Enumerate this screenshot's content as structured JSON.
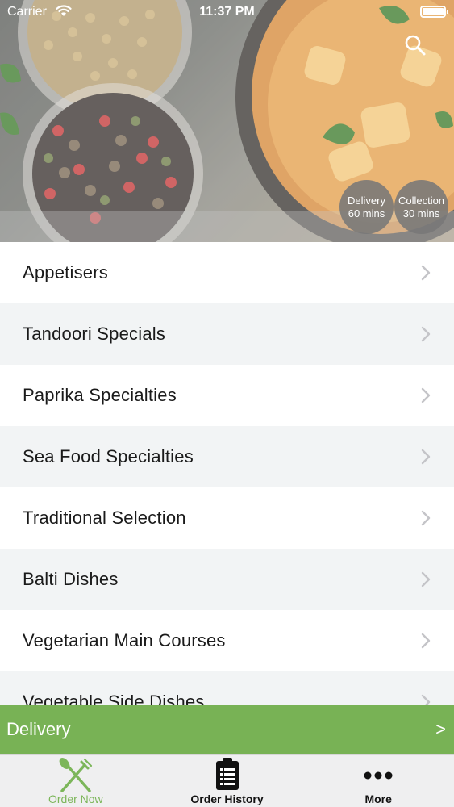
{
  "status_bar": {
    "carrier": "Carrier",
    "time": "11:37 PM"
  },
  "hero": {
    "delivery_label": "Delivery",
    "delivery_time": "60 mins",
    "collection_label": "Collection",
    "collection_time": "30 mins"
  },
  "menu": {
    "items": [
      {
        "label": "Appetisers"
      },
      {
        "label": "Tandoori Specials"
      },
      {
        "label": "Paprika Specialties"
      },
      {
        "label": "Sea Food Specialties"
      },
      {
        "label": "Traditional Selection"
      },
      {
        "label": "Balti Dishes"
      },
      {
        "label": "Vegetarian Main Courses"
      },
      {
        "label": "Vegetable Side Dishes"
      }
    ]
  },
  "order_bar": {
    "label": "Delivery",
    "arrow": ">"
  },
  "tabs": [
    {
      "label": "Order Now",
      "icon": "fork-knife-icon",
      "active": true
    },
    {
      "label": "Order History",
      "icon": "clipboard-list-icon",
      "active": false
    },
    {
      "label": "More",
      "icon": "more-dots-icon",
      "active": false
    }
  ],
  "colors": {
    "accent": "#78b255",
    "active_tab": "#7cb65a",
    "row_alt": "#f2f4f5"
  }
}
